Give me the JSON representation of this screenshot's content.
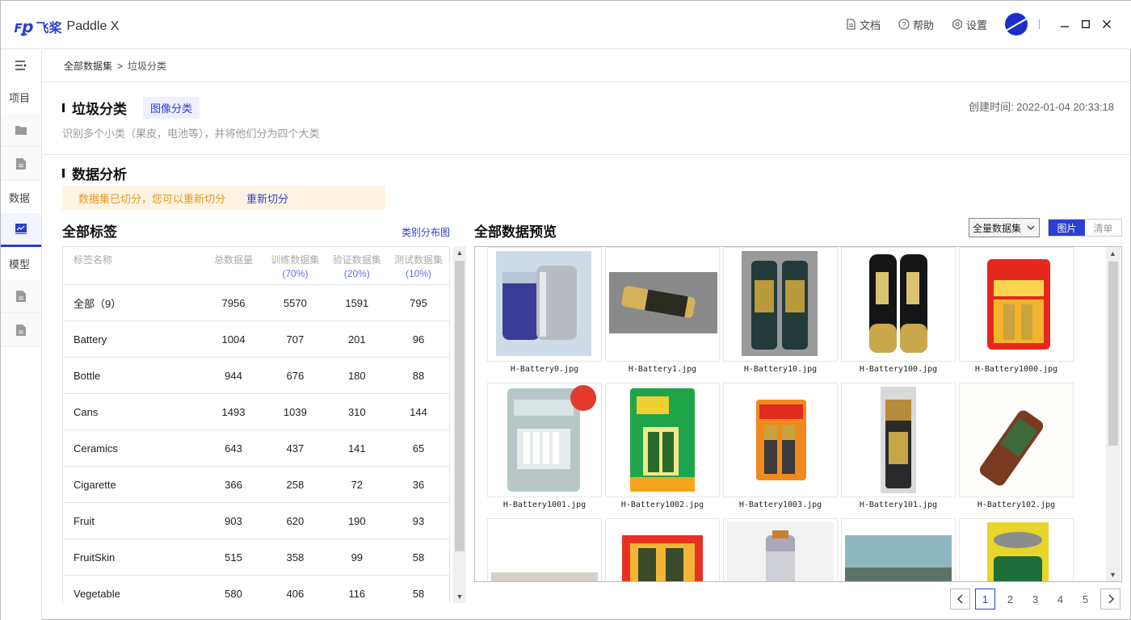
{
  "app": {
    "logo_mark": "ꜰꝑ",
    "logo_cn": "飞桨",
    "logo_en": "Paddle X"
  },
  "topbar": {
    "docs": "文档",
    "help": "帮助",
    "settings": "设置"
  },
  "rail": {
    "project_label": "项目",
    "data_label": "数据",
    "model_label": "模型"
  },
  "breadcrumb": {
    "root": "全部数据集",
    "sep": ">",
    "current": "垃圾分类"
  },
  "dataset": {
    "title": "垃圾分类",
    "type_tag": "图像分类",
    "created": "创建时间: 2022-01-04 20:33:18",
    "description": "识别多个小类（果皮，电池等），并将他们分为四个大类"
  },
  "analysis": {
    "title": "数据分析",
    "notice": "数据集已切分，您可以重新切分",
    "resplit_link": "重新切分"
  },
  "labels": {
    "title": "全部标签",
    "dist_link": "类别分布图",
    "headers": {
      "name": "标签名称",
      "total": "总数据量",
      "train": "训练数据集",
      "train_pct": "(70%)",
      "val": "验证数据集",
      "val_pct": "(20%)",
      "test": "测试数据集",
      "test_pct": "(10%)"
    },
    "rows": [
      {
        "name": "全部（9）",
        "total": "7956",
        "train": "5570",
        "val": "1591",
        "test": "795"
      },
      {
        "name": "Battery",
        "total": "1004",
        "train": "707",
        "val": "201",
        "test": "96"
      },
      {
        "name": "Bottle",
        "total": "944",
        "train": "676",
        "val": "180",
        "test": "88"
      },
      {
        "name": "Cans",
        "total": "1493",
        "train": "1039",
        "val": "310",
        "test": "144"
      },
      {
        "name": "Ceramics",
        "total": "643",
        "train": "437",
        "val": "141",
        "test": "65"
      },
      {
        "name": "Cigarette",
        "total": "366",
        "train": "258",
        "val": "72",
        "test": "36"
      },
      {
        "name": "Fruit",
        "total": "903",
        "train": "620",
        "val": "190",
        "test": "93"
      },
      {
        "name": "FruitSkin",
        "total": "515",
        "train": "358",
        "val": "99",
        "test": "58"
      },
      {
        "name": "Vegetable",
        "total": "580",
        "train": "406",
        "val": "116",
        "test": "58"
      }
    ]
  },
  "preview": {
    "title": "全部数据预览",
    "filter_value": "全量数据集",
    "view_image": "图片",
    "view_list": "清单",
    "images": [
      {
        "file": "H-Battery0.jpg",
        "kind": "cylinders-blue"
      },
      {
        "file": "H-Battery1.jpg",
        "kind": "aa-gold"
      },
      {
        "file": "H-Battery10.jpg",
        "kind": "aa-pair-dark"
      },
      {
        "file": "H-Battery100.jpg",
        "kind": "aa-pair-black"
      },
      {
        "file": "H-Battery1000.jpg",
        "kind": "pack-red"
      },
      {
        "file": "H-Battery1001.jpg",
        "kind": "pack-charger"
      },
      {
        "file": "H-Battery1002.jpg",
        "kind": "pack-green"
      },
      {
        "file": "H-Battery1003.jpg",
        "kind": "pack-small-red"
      },
      {
        "file": "H-Battery101.jpg",
        "kind": "aa-single"
      },
      {
        "file": "H-Battery102.jpg",
        "kind": "aa-tilted"
      },
      {
        "file": "",
        "kind": "aa-partial"
      },
      {
        "file": "",
        "kind": "pack-partial"
      },
      {
        "file": "",
        "kind": "small-partial"
      },
      {
        "file": "",
        "kind": "photo-partial"
      },
      {
        "file": "",
        "kind": "c-partial"
      }
    ]
  },
  "pager": {
    "pages": [
      "1",
      "2",
      "3",
      "4",
      "5"
    ],
    "current": "1"
  }
}
